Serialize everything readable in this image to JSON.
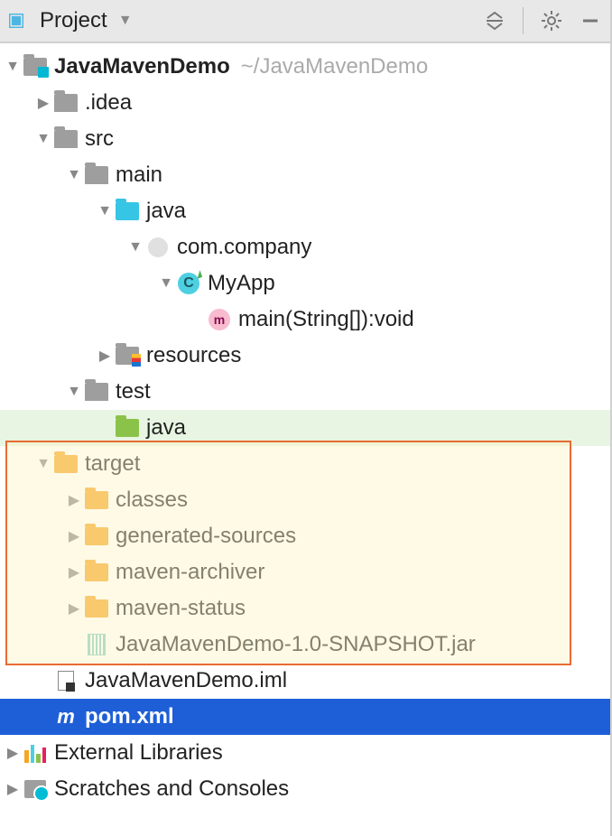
{
  "header": {
    "title": "Project"
  },
  "tree": {
    "root": {
      "name": "JavaMavenDemo",
      "path": "~/JavaMavenDemo"
    },
    "idea": ".idea",
    "src": "src",
    "main": "main",
    "java1": "java",
    "pkg": "com.company",
    "class": "MyApp",
    "method": "main(String[]):void",
    "resources": "resources",
    "test": "test",
    "java2": "java",
    "target": "target",
    "classes": "classes",
    "gensrc": "generated-sources",
    "archiver": "maven-archiver",
    "status": "maven-status",
    "jar": "JavaMavenDemo-1.0-SNAPSHOT.jar",
    "iml": "JavaMavenDemo.iml",
    "pom": "pom.xml",
    "ext": "External Libraries",
    "scratch": "Scratches and Consoles"
  }
}
